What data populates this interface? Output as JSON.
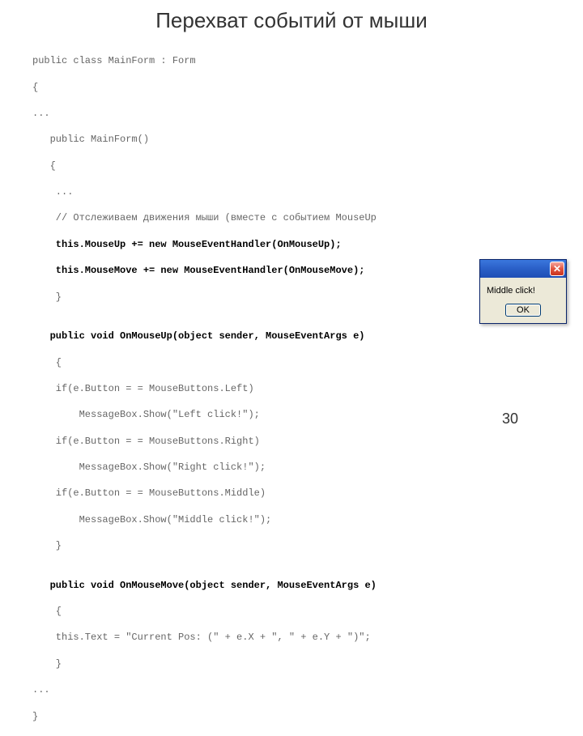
{
  "title": "Перехват событий от мыши",
  "page_number": "30",
  "code": {
    "l1": "public class MainForm : Form",
    "l2": "{",
    "l3": "...",
    "l4": "   public MainForm()",
    "l5": "   {",
    "l6": "    ...",
    "l7": "    // Отслеживаем движения мыши (вместе с событием MouseUp",
    "l8": "    this.MouseUp += new MouseEventHandler(OnMouseUp);",
    "l9": "    this.MouseMove += new MouseEventHandler(OnMouseMove);",
    "l10": "    }",
    "l11": "",
    "l12": "   public void OnMouseUp(object sender, MouseEventArgs e)",
    "l13": "    {",
    "l14": "    if(e.Button = = MouseButtons.Left)",
    "l15": "        MessageBox.Show(\"Left click!\");",
    "l16": "    if(e.Button = = MouseButtons.Right)",
    "l17": "        MessageBox.Show(\"Right click!\");",
    "l18": "    if(e.Button = = MouseButtons.Middle)",
    "l19": "        MessageBox.Show(\"Middle click!\");",
    "l20": "    }",
    "l21": "",
    "l22": "   public void OnMouseMove(object sender, MouseEventArgs e)",
    "l23": "    {",
    "l24": "    this.Text = \"Current Pos: (\" + e.X + \", \" + e.Y + \")\";",
    "l25": "    }",
    "l26": "...",
    "l27": "}"
  },
  "dialog": {
    "message": "Middle click!",
    "ok_label": "OK"
  }
}
